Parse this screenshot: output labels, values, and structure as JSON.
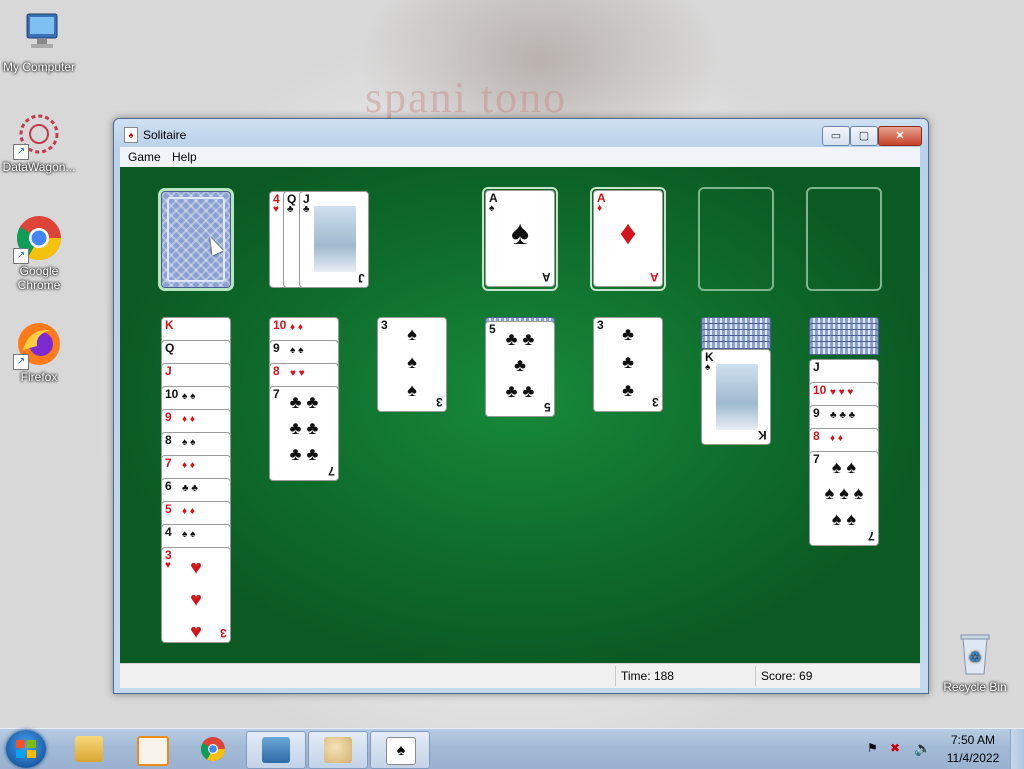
{
  "desktop": {
    "wallpaper_text": "spani tono",
    "icons": [
      {
        "label": "My Computer"
      },
      {
        "label": "DataWagon..."
      },
      {
        "label": "Google Chrome"
      },
      {
        "label": "Firefox"
      },
      {
        "label": "Recycle Bin"
      }
    ]
  },
  "window": {
    "title": "Solitaire",
    "controls": {
      "minimize": "▭",
      "maximize": "▢",
      "close": "✕"
    },
    "menu": [
      "Game",
      "Help"
    ]
  },
  "game": {
    "waste": [
      "4",
      "Q",
      "J"
    ],
    "foundations": [
      {
        "rank": "A",
        "suit": "♠",
        "color": "black"
      },
      {
        "rank": "A",
        "suit": "♦",
        "color": "red"
      }
    ],
    "tableau": [
      {
        "cards": [
          "K",
          "Q",
          "J",
          "10",
          "9",
          "8",
          "7",
          "6",
          "5",
          "4",
          "3"
        ]
      },
      {
        "cards": [
          "10",
          "9",
          "8",
          "7"
        ]
      },
      {
        "cards": [
          "3"
        ]
      },
      {
        "cards": [
          "5"
        ]
      },
      {
        "cards": [
          "3"
        ]
      },
      {
        "cards": [
          "K"
        ]
      },
      {
        "cards": [
          "J",
          "10",
          "9",
          "8",
          "7"
        ]
      }
    ]
  },
  "status": {
    "time": "Time:  188",
    "score": "Score: 69"
  },
  "taskbar": {
    "clock_time": "7:50 AM",
    "clock_date": "11/4/2022"
  }
}
